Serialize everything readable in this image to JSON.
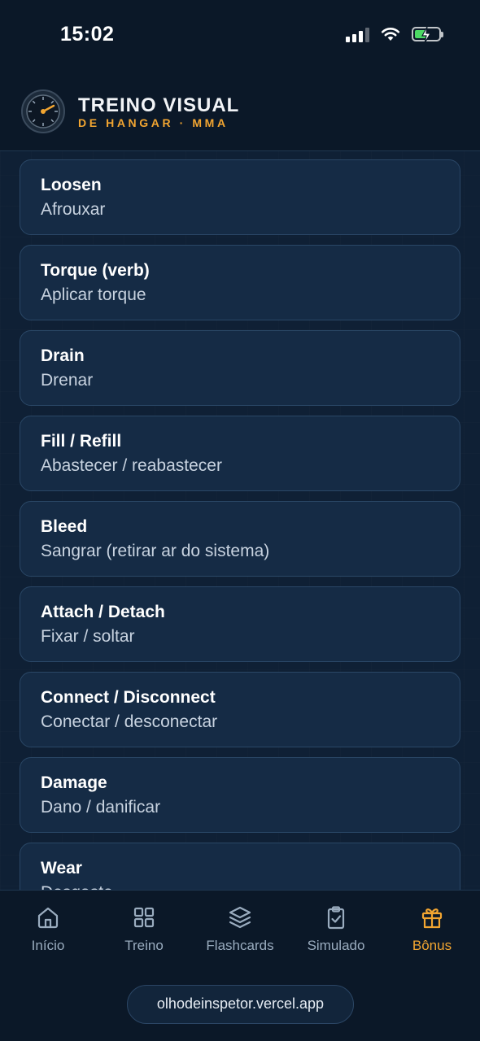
{
  "status_bar": {
    "time": "15:02"
  },
  "header": {
    "title": "TREINO VISUAL",
    "subtitle": "DE HANGAR · MMA",
    "accent_color": "#f2a531"
  },
  "cards": [
    {
      "term": "Loosen",
      "translation": "Afrouxar"
    },
    {
      "term": "Torque (verb)",
      "translation": "Aplicar torque"
    },
    {
      "term": "Drain",
      "translation": "Drenar"
    },
    {
      "term": "Fill / Refill",
      "translation": "Abastecer / reabastecer"
    },
    {
      "term": "Bleed",
      "translation": "Sangrar (retirar ar do sistema)"
    },
    {
      "term": "Attach / Detach",
      "translation": "Fixar / soltar"
    },
    {
      "term": "Connect / Disconnect",
      "translation": "Conectar / desconectar"
    },
    {
      "term": "Damage",
      "translation": "Dano / danificar"
    },
    {
      "term": "Wear",
      "translation": "Desgaste"
    }
  ],
  "nav": {
    "items": [
      {
        "label": "Início",
        "icon": "home-icon"
      },
      {
        "label": "Treino",
        "icon": "grid-icon"
      },
      {
        "label": "Flashcards",
        "icon": "layers-icon"
      },
      {
        "label": "Simulado",
        "icon": "clipboard-check-icon"
      },
      {
        "label": "Bônus",
        "icon": "gift-icon",
        "active": true
      }
    ]
  },
  "browser": {
    "url": "olhodeinspetor.vercel.app"
  }
}
